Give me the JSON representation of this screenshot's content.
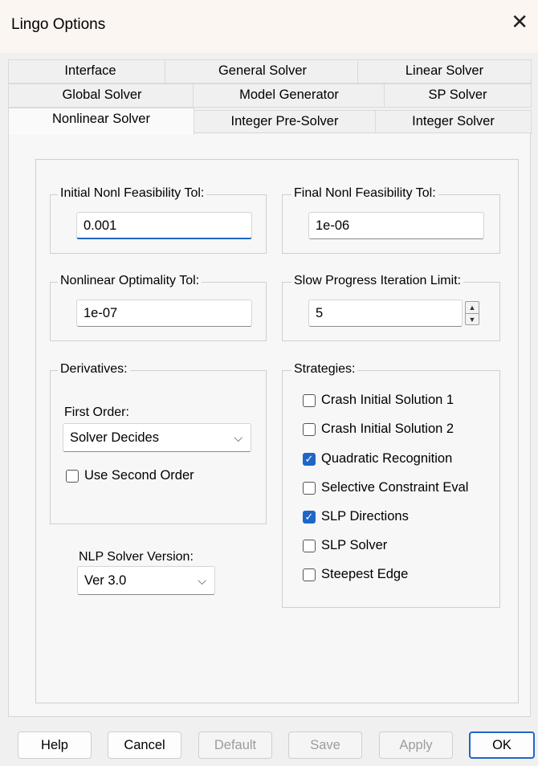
{
  "window": {
    "title": "Lingo Options",
    "close_glyph": "✕"
  },
  "tabs": {
    "row1": [
      "Interface",
      "General Solver",
      "Linear Solver"
    ],
    "row2": [
      "Global Solver",
      "Model Generator",
      "SP Solver"
    ],
    "row3": [
      "Nonlinear Solver",
      "Integer Pre-Solver",
      "Integer Solver"
    ],
    "active": "Nonlinear Solver"
  },
  "initial_feas": {
    "label": "Initial Nonl Feasibility Tol:",
    "value": "0.001"
  },
  "final_feas": {
    "label": "Final Nonl Feasibility Tol:",
    "value": "1e-06"
  },
  "optimality": {
    "label": "Nonlinear Optimality Tol:",
    "value": "1e-07"
  },
  "slow_progress": {
    "label": "Slow Progress Iteration Limit:",
    "value": "5"
  },
  "derivatives": {
    "label": "Derivatives:",
    "first_order_label": "First Order:",
    "first_order_value": "Solver Decides",
    "second_order_label": "Use Second Order",
    "second_order_checked": false
  },
  "nlp_version": {
    "label": "NLP Solver Version:",
    "value": "Ver 3.0"
  },
  "strategies": {
    "label": "Strategies:",
    "items": [
      {
        "label": "Crash Initial Solution 1",
        "checked": false
      },
      {
        "label": "Crash Initial Solution 2",
        "checked": false
      },
      {
        "label": "Quadratic Recognition",
        "checked": true
      },
      {
        "label": "Selective Constraint Eval",
        "checked": false
      },
      {
        "label": "SLP Directions",
        "checked": true
      },
      {
        "label": "SLP Solver",
        "checked": false
      },
      {
        "label": "Steepest Edge",
        "checked": false
      }
    ]
  },
  "buttons": {
    "help": "Help",
    "cancel": "Cancel",
    "default": "Default",
    "save": "Save",
    "apply": "Apply",
    "ok": "OK"
  },
  "colors": {
    "accent": "#1f66c8",
    "title_bg": "#fbf6f1"
  },
  "icons": {
    "check": "✓",
    "chevron": "⌵",
    "spin_up": "▲",
    "spin_down": "▼"
  }
}
